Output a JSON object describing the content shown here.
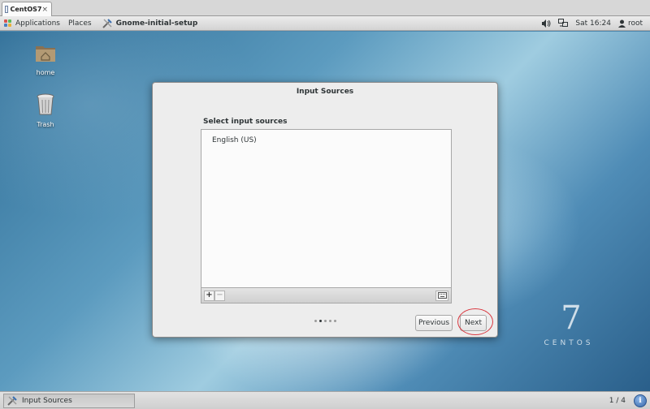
{
  "vm_tab": {
    "label": "CentOS7",
    "close": "×"
  },
  "top_panel": {
    "applications": "Applications",
    "places": "Places",
    "window_title": "Gnome-initial-setup",
    "clock": "Sat 16:24",
    "user": "root"
  },
  "desktop": {
    "icons": [
      {
        "label": "home",
        "icon": "home-folder-icon"
      },
      {
        "label": "Trash",
        "icon": "trash-icon"
      }
    ],
    "branding": {
      "number": "7",
      "word": "CENTOS"
    }
  },
  "dialog": {
    "title": "Input Sources",
    "section_label": "Select input sources",
    "sources": [
      "English (US)"
    ],
    "toolbar": {
      "add": "+",
      "remove": "−"
    },
    "page_count": 5,
    "active_page": 2,
    "previous_label": "Previous",
    "next_label": "Next"
  },
  "taskbar": {
    "task_label": "Input Sources",
    "workspace": "1 / 4",
    "info": "i"
  },
  "colors": {
    "panel": "#d3d3d3",
    "dialog_bg": "#ededed",
    "highlight_circle": "#d9363e",
    "desktop_blue": "#4d87ad"
  }
}
